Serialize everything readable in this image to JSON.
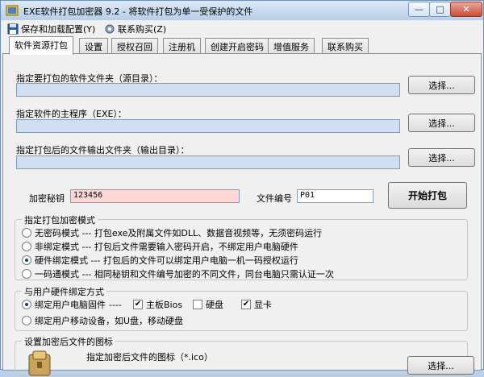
{
  "window": {
    "title": "EXE软件打包加密器 9.2 - 将软件打包为单一受保护的文件",
    "min_label": "—",
    "max_label": "□",
    "close_label": "✕"
  },
  "menu": {
    "items": [
      {
        "label": "保存和加载配置(Y)",
        "icon": "save-disk-icon"
      },
      {
        "label": "联系购买(Z)",
        "icon": "gear-icon"
      }
    ]
  },
  "tabs": [
    {
      "label": "软件资源打包",
      "active": true
    },
    {
      "label": "设置"
    },
    {
      "label": "授权召回"
    },
    {
      "label": "注册机"
    },
    {
      "label": "创建开启密码"
    },
    {
      "label": "增值服务"
    },
    {
      "label": "联系购买"
    }
  ],
  "fields": {
    "source_dir_label": "指定要打包的软件文件夹（源目录）：",
    "main_exe_label": "指定软件的主程序（EXE）：",
    "output_dir_label": "指定打包后的文件输出文件夹（输出目录）：",
    "select_label": "选择...",
    "password_label": "加密秘钥",
    "password_value": "123456",
    "file_no_label": "文件编号",
    "file_no_value": "P01",
    "start_label": "开始打包"
  },
  "mode_group": {
    "title": "指定打包加密模式",
    "options": [
      {
        "label": "无密码模式 --- 打包exe及附属文件如DLL、数据音视频等，无须密码运行",
        "checked": false
      },
      {
        "label": "非绑定模式 --- 打包后文件需要输入密码开启，不绑定用户电脑硬件",
        "checked": false
      },
      {
        "label": "硬件绑定模式 --- 打包后的文件可以绑定用户电脑一机一码授权运行",
        "checked": true
      },
      {
        "label": "一码通模式 --- 相同秘钥和文件编号加密的不同文件，同台电脑只需认证一次",
        "checked": false
      }
    ]
  },
  "hw_group": {
    "title": "与用户硬件绑定方式",
    "bind_pc_label": "绑定用户电脑固件",
    "dashes": "----",
    "checks": [
      {
        "label": "主板Bios",
        "checked": true
      },
      {
        "label": "硬盘",
        "checked": false
      },
      {
        "label": "显卡",
        "checked": true
      }
    ],
    "bind_mobile_label": "绑定用户移动设备，如U盘，移动硬盘"
  },
  "icon_group": {
    "title": "设置加密后文件的图标",
    "icon_path_label": "指定加密后文件的图标（*.ico）"
  },
  "colors": {
    "path_field": "#cfdff1",
    "password_field": "#ffd6d6"
  }
}
